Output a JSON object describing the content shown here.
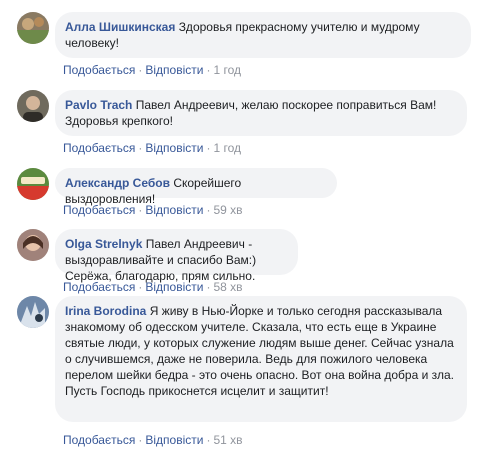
{
  "comments": [
    {
      "author": "Алла Шишкинская",
      "text": "Здоровья прекрасному учителю и мудрому человеку!",
      "like_label": "Подобається",
      "reply_label": "Відповісти",
      "time": "1 год",
      "avatar_color": "#8a7a62"
    },
    {
      "author": "Pavlo Trach",
      "text": "Павел Андреевич, желаю поскорее поправиться Вам! Здоровья крепкого!",
      "like_label": "Подобається",
      "reply_label": "Відповісти",
      "time": "1 год",
      "avatar_color": "#6f6a5d"
    },
    {
      "author": "Александр Себов",
      "text": "Скорейшего выздоровления!",
      "like_label": "Подобається",
      "reply_label": "Відповісти",
      "time": "59 хв",
      "avatar_color": "#5b8a3e"
    },
    {
      "author": "Olga Strelnyk",
      "text": "Павел Андреевич - выздоравливайте и спасибо Вам:) Серёжа, благодарю, прям сильно.",
      "like_label": "Подобається",
      "reply_label": "Відповісти",
      "time": "58 хв",
      "avatar_color": "#a0827a"
    },
    {
      "author": "Irina Borodina",
      "text": "Я живу в Нью-Йорке и только сегодня рассказывала знакомому об одесском учителе. Сказала, что есть еще в Украине святые люди, у которых служение людям выше денег. Сейчас узнала о случившемся, даже не поверила. Ведь для пожилого человека перелом шейки бедра - это очень опасно. Вот она война добра и зла. Пусть Господь прикоснется исцелит и защитит!",
      "like_label": "Подобається",
      "reply_label": "Відповісти",
      "time": "51 хв",
      "avatar_color": "#6d87a8"
    }
  ]
}
